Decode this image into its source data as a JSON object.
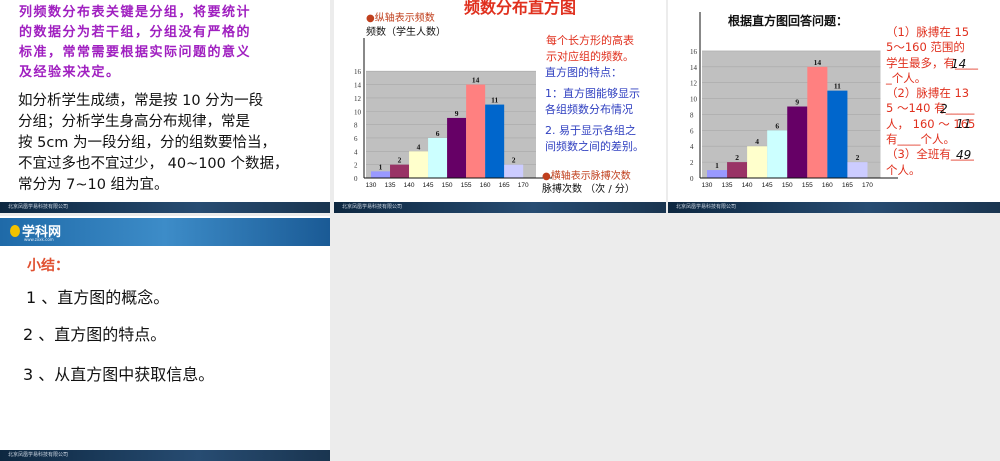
{
  "slide1": {
    "purple_lines": [
      "列频数分布表关键是分组，将要统计",
      "的数据分为若干组，分组没有严格的",
      "标准，常常需要根据实际问题的意义",
      "及经验来决定。"
    ],
    "black_lines": [
      "如分析学生成绩，常是按 10 分为一段",
      "分组；分析学生身高分布规律，常是",
      "按 5cm 为一段分组，分的组数要恰当，",
      "不宜过多也不宜过少， 40~100 个数据，",
      "常分为 7~10 组为宜。"
    ]
  },
  "slide2": {
    "title": "频数分布直方图",
    "y_note": "●纵轴表示频数",
    "y_label": "频数（学生人数）",
    "x_note": "●横轴表示脉搏次数",
    "x_label": "脉搏次数 （次 / 分）",
    "red_lines": [
      "每个长方形的高表",
      "示对应组的频数。"
    ],
    "blue_lines": [
      "直方图的特点：",
      "1：直方图能够显示",
      "各组频数分布情况",
      "2. 易于显示各组之",
      "间频数之间的差别。"
    ]
  },
  "slide3": {
    "title": "根据直方图回答问题：",
    "q_lines": [
      "（1）脉搏在 15",
      "5～160 范围的",
      "学生最多，有____",
      "_个人。",
      "（2）脉搏在 13",
      "5 ～140 有_____",
      "人， 160 ～ 165",
      "有____个人。",
      "（3）全班有____",
      "个人。"
    ],
    "answers": [
      "14",
      "2",
      "11",
      "49"
    ]
  },
  "slide4": {
    "logo": "学科网",
    "logo_sub": "www.zxxk.com",
    "heading": "小结：",
    "items": [
      "1 、直方图的概念。",
      "2 、直方图的特点。",
      "3 、从直方图中获取信息。"
    ]
  },
  "footer_text": "北京凤凰学易科技有限公司",
  "chart_data": {
    "type": "bar",
    "title": "频数分布直方图",
    "xlabel": "脉搏次数 （次 / 分）",
    "ylabel": "频数（学生人数）",
    "x_ticks": [
      "130",
      "135",
      "140",
      "145",
      "150",
      "155",
      "160",
      "165",
      "170"
    ],
    "bins": [
      "130-135",
      "135-140",
      "140-145",
      "145-150",
      "150-155",
      "155-160",
      "160-165",
      "165-170"
    ],
    "values": [
      1,
      2,
      4,
      6,
      9,
      14,
      11,
      2
    ],
    "ylim": [
      0,
      16
    ],
    "y_ticks": [
      0,
      2,
      4,
      6,
      8,
      10,
      12,
      14,
      16
    ],
    "colors": [
      "#9999ff",
      "#993366",
      "#ffffcc",
      "#ccffff",
      "#660066",
      "#ff8080",
      "#0066cc",
      "#ccccff"
    ]
  }
}
